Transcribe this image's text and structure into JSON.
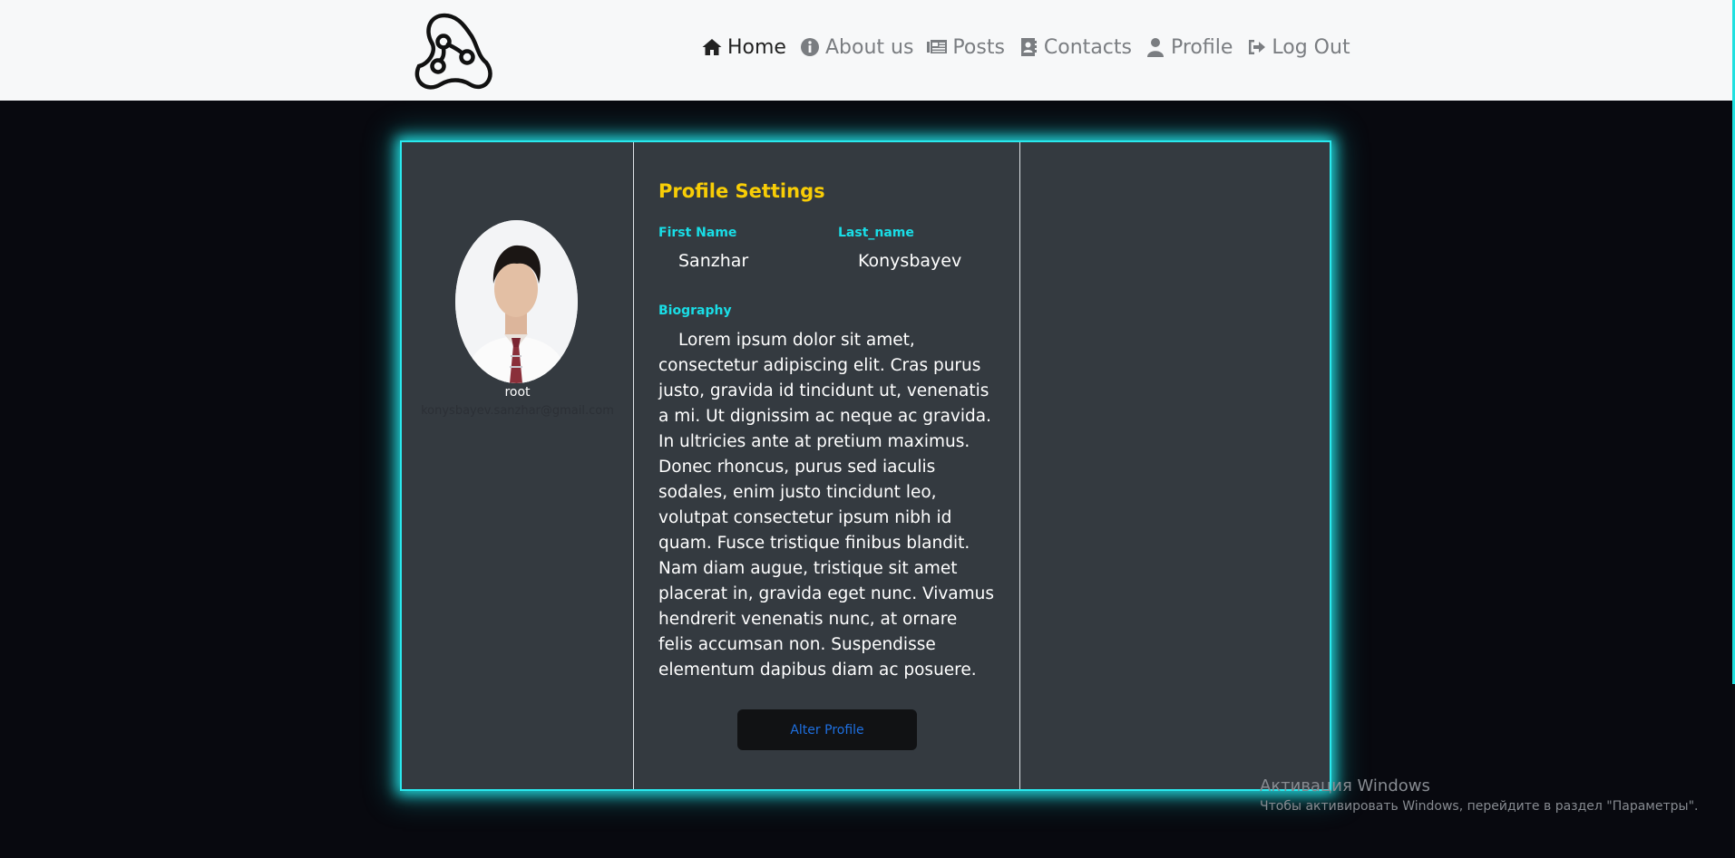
{
  "nav": {
    "items": [
      {
        "label": "Home",
        "icon": "home-icon",
        "active": true
      },
      {
        "label": "About us",
        "icon": "info-circle-icon",
        "active": false
      },
      {
        "label": "Posts",
        "icon": "newspaper-icon",
        "active": false
      },
      {
        "label": "Contacts",
        "icon": "address-book-icon",
        "active": false
      },
      {
        "label": "Profile",
        "icon": "user-icon",
        "active": false
      },
      {
        "label": "Log Out",
        "icon": "sign-out-icon",
        "active": false
      }
    ]
  },
  "profile": {
    "username": "root",
    "email": "konysbayev.sanzhar@gmail.com"
  },
  "settings": {
    "title": "Profile Settings",
    "first_name_label": "First Name",
    "first_name_value": "Sanzhar",
    "last_name_label": "Last_name",
    "last_name_value": "Konysbayev",
    "biography_label": "Biography",
    "biography_text": "Lorem ipsum dolor sit amet, consectetur adipiscing elit. Cras purus justo, gravida id tincidunt ut, venenatis a mi. Ut dignissim ac neque ac gravida. In ultricies ante at pretium maximus. Donec rhoncus, purus sed iaculis sodales, enim justo tincidunt leo, volutpat consectetur ipsum nibh id quam. Fusce tristique finibus blandit. Nam diam augue, tristique sit amet placerat in, gravida eget nunc. Vivamus hendrerit venenatis nunc, at ornare felis accumsan non. Suspendisse elementum dapibus diam ac posuere.",
    "alter_button": "Alter Profile"
  },
  "watermark": {
    "title": "Активация Windows",
    "subtitle": "Чтобы активировать Windows, перейдите в раздел \"Параметры\"."
  },
  "colors": {
    "accent_glow": "#29e9ee",
    "title_yellow": "#f8cd06",
    "label_cyan": "#19dde6",
    "card_bg": "#343a40",
    "button_text": "#1e6fe0"
  }
}
